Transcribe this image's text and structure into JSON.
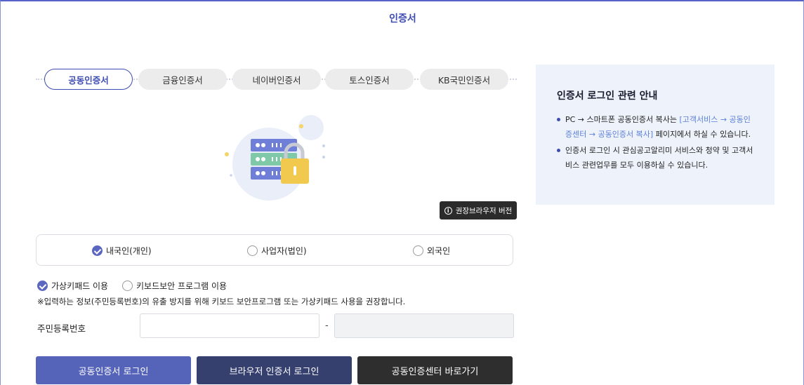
{
  "page": {
    "title": "인증서"
  },
  "tabs": [
    {
      "label": "공동인증서",
      "active": true
    },
    {
      "label": "금융인증서",
      "active": false
    },
    {
      "label": "네이버인증서",
      "active": false
    },
    {
      "label": "토스인증서",
      "active": false
    },
    {
      "label": "KB국민인증서",
      "active": false
    }
  ],
  "browser_badge": {
    "icon": "info-icon",
    "label": "권장브라우저 버전"
  },
  "user_types": [
    {
      "label": "내국인(개인)",
      "checked": true
    },
    {
      "label": "사업자(법인)",
      "checked": false
    },
    {
      "label": "외국인",
      "checked": false
    }
  ],
  "input_methods": [
    {
      "label": "가상키패드 이용",
      "checked": true
    },
    {
      "label": "키보드보안 프로그램 이용",
      "checked": false
    }
  ],
  "notice": "※입력하는 정보(주민등록번호)의 유출 방지를 위해 키보드 보안프로그램 또는 가상키패드 사용을 권장합니다.",
  "rrn": {
    "label": "주민등록번호",
    "separator": "-",
    "front_value": "",
    "back_value": ""
  },
  "buttons": {
    "cert_login": "공동인증서 로그인",
    "browser_login": "브라우저 인증서 로그인",
    "center_link": "공동인증센터 바로가기"
  },
  "guide": {
    "title": "인증서 로그인 관련 안내",
    "item1_pre": "PC → 스마트폰 공동인증서 복사는 ",
    "item1_link": "[고객서비스 → 공동인증센터 → 공동인증서 복사]",
    "item1_post": " 페이지에서 하실 수 있습니다.",
    "item2": "인증서 로그인 시 관심공고알리미 서비스와 청약 및 고객서비스 관련업무를 모두 이용하실 수 있습니다."
  },
  "colors": {
    "accent": "#3d4cb0",
    "btn_primary": "#5563b8",
    "btn_secondary": "#36406f",
    "btn_dark": "#2e2e2e",
    "guide_bg": "#eef3fb"
  }
}
